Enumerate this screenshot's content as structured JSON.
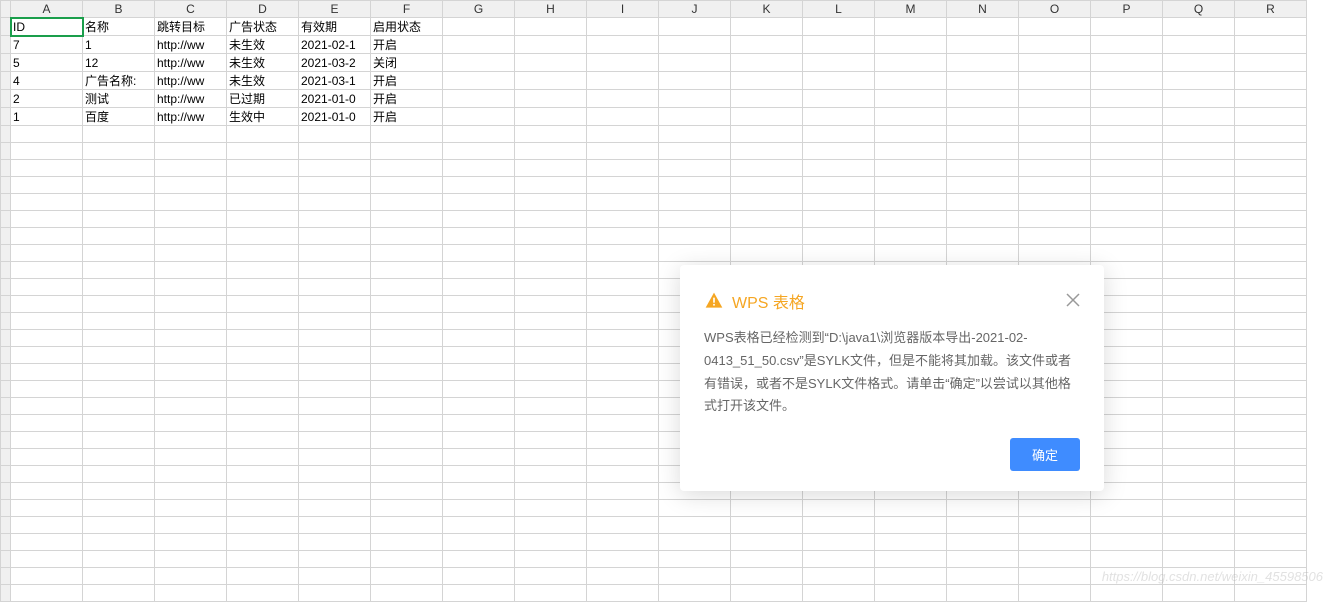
{
  "columns": [
    "A",
    "B",
    "C",
    "D",
    "E",
    "F",
    "G",
    "H",
    "I",
    "J",
    "K",
    "L",
    "M",
    "N",
    "O",
    "P",
    "Q",
    "R"
  ],
  "selected_cell": "A1",
  "rows": [
    [
      "ID",
      "名称",
      "跳转目标",
      "广告状态",
      "有效期",
      "启用状态",
      "",
      "",
      "",
      "",
      "",
      "",
      "",
      "",
      "",
      "",
      "",
      ""
    ],
    [
      "7",
      "1",
      "http://ww",
      "未生效",
      "2021-02-1",
      "开启",
      "",
      "",
      "",
      "",
      "",
      "",
      "",
      "",
      "",
      "",
      "",
      ""
    ],
    [
      "5",
      "12",
      "http://ww",
      "未生效",
      "2021-03-2",
      "关闭",
      "",
      "",
      "",
      "",
      "",
      "",
      "",
      "",
      "",
      "",
      "",
      ""
    ],
    [
      "4",
      "广告名称:",
      "http://ww",
      "未生效",
      "2021-03-1",
      "开启",
      "",
      "",
      "",
      "",
      "",
      "",
      "",
      "",
      "",
      "",
      "",
      ""
    ],
    [
      "2",
      "测试",
      "http://ww",
      "已过期",
      "2021-01-0",
      "开启",
      "",
      "",
      "",
      "",
      "",
      "",
      "",
      "",
      "",
      "",
      "",
      ""
    ],
    [
      "1",
      "百度",
      "http://ww",
      "生效中",
      "2021-01-0",
      "开启",
      "",
      "",
      "",
      "",
      "",
      "",
      "",
      "",
      "",
      "",
      "",
      ""
    ]
  ],
  "empty_row_count": 28,
  "dialog": {
    "title": "WPS 表格",
    "message": "WPS表格已经检测到“D:\\java1\\浏览器版本导出-2021-02-0413_51_50.csv”是SYLK文件，但是不能将其加载。该文件或者有错误，或者不是SYLK文件格式。请单击“确定”以尝试以其他格式打开该文件。",
    "ok_label": "确定"
  },
  "watermark": "https://blog.csdn.net/weixin_45598506"
}
